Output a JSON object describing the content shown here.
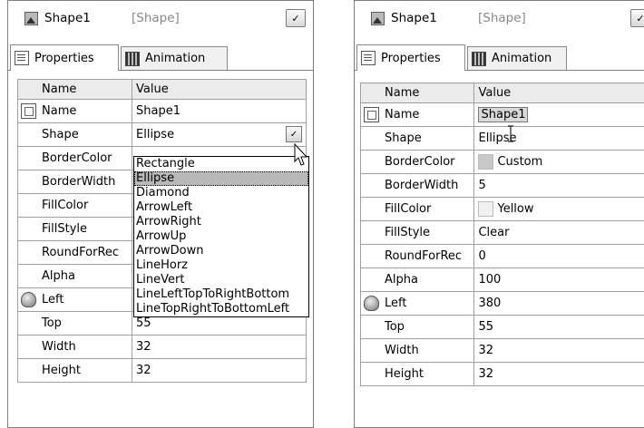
{
  "left": {
    "selector": {
      "name": "Shape1",
      "type": "[Shape]"
    },
    "tabs": [
      {
        "label": "Properties"
      },
      {
        "label": "Animation"
      }
    ],
    "grid": {
      "headers": {
        "name": "Name",
        "value": "Value"
      },
      "rows": [
        {
          "name": "Name",
          "value": "Shape1"
        },
        {
          "name": "Shape",
          "value": "Ellipse"
        },
        {
          "name": "BorderColor",
          "value": ""
        },
        {
          "name": "BorderWidth",
          "value": ""
        },
        {
          "name": "FillColor",
          "value": ""
        },
        {
          "name": "FillStyle",
          "value": ""
        },
        {
          "name": "RoundForRec",
          "value": ""
        },
        {
          "name": "Alpha",
          "value": ""
        },
        {
          "name": "Left",
          "value": ""
        },
        {
          "name": "Top",
          "value": "55"
        },
        {
          "name": "Width",
          "value": "32"
        },
        {
          "name": "Height",
          "value": "32"
        }
      ]
    },
    "dropdown": {
      "options": [
        "Rectangle",
        "Ellipse",
        "Diamond",
        "ArrowLeft",
        "ArrowRight",
        "ArrowUp",
        "ArrowDown",
        "LineHorz",
        "LineVert",
        "LineLeftTopToRightBottom",
        "LineTopRightToBottomLeft"
      ],
      "selected": "Ellipse"
    }
  },
  "right": {
    "selector": {
      "name": "Shape1",
      "type": "[Shape]"
    },
    "tabs": [
      {
        "label": "Properties"
      },
      {
        "label": "Animation"
      }
    ],
    "grid": {
      "headers": {
        "name": "Name",
        "value": "Value"
      },
      "rows": [
        {
          "name": "Name",
          "value": "Shape1"
        },
        {
          "name": "Shape",
          "value": "Ellipse"
        },
        {
          "name": "BorderColor",
          "value": "Custom",
          "swatch": "#c8c8c8"
        },
        {
          "name": "BorderWidth",
          "value": "5"
        },
        {
          "name": "FillColor",
          "value": "Yellow",
          "swatch": "#f0f0f0"
        },
        {
          "name": "FillStyle",
          "value": "Clear"
        },
        {
          "name": "RoundForRec",
          "value": "0"
        },
        {
          "name": "Alpha",
          "value": "100"
        },
        {
          "name": "Left",
          "value": "380"
        },
        {
          "name": "Top",
          "value": "55"
        },
        {
          "name": "Width",
          "value": "32"
        },
        {
          "name": "Height",
          "value": "32"
        }
      ]
    }
  },
  "icons": {
    "dropdown": "chevron-down-icon",
    "name_row": "property-name-icon",
    "left_row": "position-icon"
  }
}
